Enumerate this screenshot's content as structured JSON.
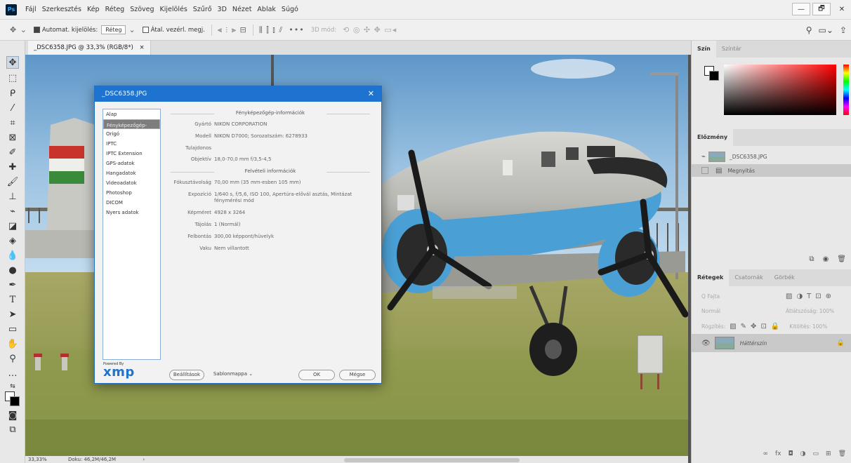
{
  "app": {
    "logo": "Ps"
  },
  "menu": [
    "Fájl",
    "Szerkesztés",
    "Kép",
    "Réteg",
    "Szöveg",
    "Kijelölés",
    "Szűrő",
    "3D",
    "Nézet",
    "Ablak",
    "Súgó"
  ],
  "options": {
    "auto_select_label": "Automat. kijelölés:",
    "auto_select_value": "Réteg",
    "transform_label": "Átal. vezérl. megj.",
    "mode_3d_label": "3D mód:"
  },
  "document": {
    "tab_title": "_DSC6358.JPG @ 33,3% (RGB/8*)",
    "zoom": "33,33%",
    "doc_info": "Doku: 46,2M/46,2M"
  },
  "color_panel": {
    "tabs": [
      "Szín",
      "Színtár"
    ]
  },
  "history_panel": {
    "tab": "Előzmény",
    "snapshot_name": "_DSC6358.JPG",
    "state": "Megnyitás"
  },
  "layers_panel": {
    "tabs": [
      "Rétegek",
      "Csatornák",
      "Görbék"
    ],
    "search_placeholder": "Q Fajta",
    "blend_mode": "Normál",
    "opacity_label": "Átlátszóság:",
    "opacity_value": "100%",
    "lock_label": "Rögzítés:",
    "fill_label": "Kitöltés:",
    "fill_value": "100%",
    "layer_name": "Háttérszín"
  },
  "dialog": {
    "title": "_DSC6358.JPG",
    "categories": [
      "Alap",
      "Fényképezőgép-adatok",
      "Origó",
      "IPTC",
      "IPTC Extension",
      "GPS-adatok",
      "Hangadatok",
      "Videoadatok",
      "Photoshop",
      "DICOM",
      "Nyers adatok"
    ],
    "selected_category": 1,
    "camera_section": "Fényképezőgép-információk",
    "shot_section": "Felvételi információk",
    "fields": {
      "maker_label": "Gyártó",
      "maker_value": "NIKON CORPORATION",
      "model_label": "Modell",
      "model_value": "NIKON D7000;  Sorozatszám: 6278933",
      "owner_label": "Tulajdonos",
      "owner_value": "",
      "lens_label": "Objektív",
      "lens_value": "18,0-70,0 mm f/3,5-4,5",
      "focal_label": "Fókusztávolság",
      "focal_value": "70,00 mm  (35 mm-esben 105 mm)",
      "exposure_label": "Expozíció",
      "exposure_value": "1/640 s,  f/5,6,  ISO 100,  Apertúra-elővál asztás,  Mintázat fénymérési mód",
      "size_label": "Képméret",
      "size_value": "4928 x 3264",
      "orient_label": "Tájolás",
      "orient_value": "1 (Normál)",
      "res_label": "Felbontás",
      "res_value": "300,00 képpont/hüvelyk",
      "flash_label": "Vaku",
      "flash_value": "Nem villantott"
    },
    "powered_by": "Powered By",
    "xmp": "xmp",
    "settings_button": "Beállítások",
    "template_button": "Sablonmappa",
    "ok_button": "OK",
    "cancel_button": "Mégse"
  }
}
